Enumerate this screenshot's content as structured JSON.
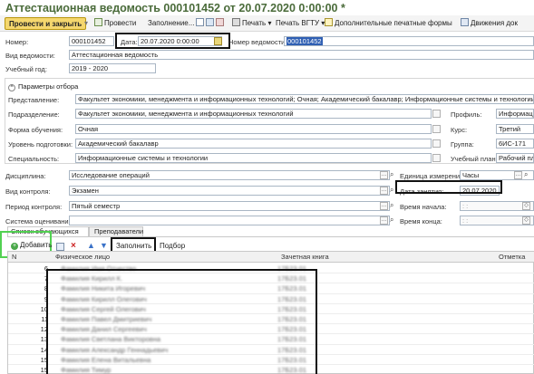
{
  "window": {
    "title": "Аттестационная ведомость 000101452 от 20.07.2020 0:00:00 *"
  },
  "toolbar": {
    "post_close": "Провести и закрыть",
    "post": "Провести",
    "fill": "Заполнение...",
    "print": "Печать",
    "print_vgtu": "Печать ВГТУ",
    "extra_print": "Дополнительные печатные формы",
    "movements": "Движения док"
  },
  "header": {
    "number_label": "Номер:",
    "number_value": "000101452",
    "date_label": "Дата:",
    "date_value": "20.07.2020  0:00:00",
    "sheet_no_label": "Номер ведомости:",
    "sheet_no_value": "000101452",
    "type_label": "Вид ведомости:",
    "type_value": "Аттестационная ведомость",
    "year_label": "Учебный год:",
    "year_value": "2019 - 2020"
  },
  "selection": {
    "group_title": "Параметры отбора",
    "representation_label": "Представление:",
    "representation_value": "Факультет экономики, менеджмента и информационных технологий; Очная; Академический бакалавр; Информационные системы и технологии; Информ",
    "subdivision_label": "Подразделение:",
    "subdivision_value": "Факультет экономики, менеджмента и информационных технологий",
    "form_label": "Форма обучения:",
    "form_value": "Очная",
    "level_label": "Уровень подготовки:",
    "level_value": "Академический бакалавр",
    "specialty_label": "Специальность:",
    "specialty_value": "Информационные системы и технологии",
    "profile_label": "Профиль:",
    "profile_value": "Информационные систе",
    "course_label": "Курс:",
    "course_value": "Третий",
    "group_label": "Группа:",
    "group_value": "6ИС-171",
    "plan_label": "Учебный план:",
    "plan_value": "Рабочий план 0000"
  },
  "discipline": {
    "discipline_label": "Дисциплина:",
    "discipline_value": "Исследование операций",
    "control_label": "Вид контроля:",
    "control_value": "Экзамен",
    "period_label": "Период контроля:",
    "period_value": "Пятый семестр",
    "grading_label": "Система оценивания:",
    "grading_value": "",
    "unit_label": "Единица измерения:",
    "unit_value": "Часы",
    "class_date_label": "Дата занятия:",
    "class_date_value": "20.07.2020",
    "start_label": "Время начала:",
    "start_value": ": :",
    "end_label": "Время конца:",
    "end_value": ": :"
  },
  "tabs": [
    {
      "label": "Список обучающихся"
    },
    {
      "label": "Преподаватели"
    }
  ],
  "table_toolbar": {
    "add": "Добавить",
    "fill": "Заполнить",
    "pick": "Подбор"
  },
  "table": {
    "columns": [
      "N",
      "Физическое лицо",
      "Зачетная книга",
      "Отметка"
    ],
    "rows": [
      {
        "n": "6",
        "name": "Фамилия Имя Отчество",
        "book": "17Б23.01"
      },
      {
        "n": "7",
        "name": "Фамилия Кирилл К.",
        "book": "17Б23.01"
      },
      {
        "n": "8",
        "name": "Фамилия Никита Игоревич",
        "book": "17Б23.01"
      },
      {
        "n": "9",
        "name": "Фамилия Кирилл Олегович",
        "book": "17Б23.01"
      },
      {
        "n": "10",
        "name": "Фамилия Сергей Олегович",
        "book": "17Б23.01"
      },
      {
        "n": "11",
        "name": "Фамилия Павел Дмитриевич",
        "book": "17Б23.01"
      },
      {
        "n": "12",
        "name": "Фамилия Данил Сергеевич",
        "book": "17Б23.01"
      },
      {
        "n": "13",
        "name": "Фамилия Светлана Викторовна",
        "book": "17Б23.01"
      },
      {
        "n": "14",
        "name": "Фамилия Александр Геннадьевич",
        "book": "17Б23.01"
      },
      {
        "n": "15",
        "name": "Фамилия Елена Витальевна",
        "book": "17Б23.01"
      },
      {
        "n": "15",
        "name": "Фамилия Тимур",
        "book": "17Б23.01"
      }
    ]
  },
  "colors": {
    "title": "#4a6b3a",
    "primary_button": "#f5d76e",
    "highlight": "#111111",
    "green_highlight": "#52d152",
    "selection": "#2f5fb3"
  }
}
